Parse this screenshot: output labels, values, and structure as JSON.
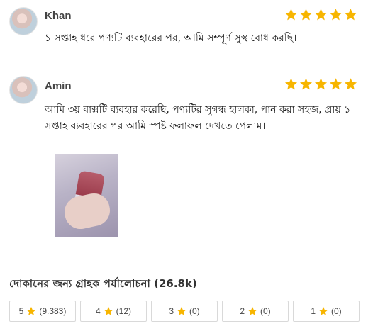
{
  "reviews": [
    {
      "name": "Khan",
      "rating": 5,
      "text": "১ সপ্তাহ ধরে পণ্যটি ব্যবহারের পর, আমি সম্পূর্ণ সুস্থ বোধ করছি।",
      "has_photo": false
    },
    {
      "name": "Amin",
      "rating": 5,
      "text": "আমি ৩য় বাক্সটি ব্যবহার করেছি, পণ্যটির সুগন্ধ হালকা, পান করা সহজ, প্রায় ১ সপ্তাহ ব্যবহারের পর আমি স্পষ্ট ফলাফল দেখতে পেলাম।",
      "has_photo": true
    }
  ],
  "summary": {
    "title": "দোকানের জন্য গ্রাহক পর্যালোচনা (26.8k)",
    "filters": [
      {
        "stars": "5",
        "count": "(9.383)"
      },
      {
        "stars": "4",
        "count": "(12)"
      },
      {
        "stars": "3",
        "count": "(0)"
      },
      {
        "stars": "2",
        "count": "(0)"
      },
      {
        "stars": "1",
        "count": "(0)"
      }
    ]
  },
  "colors": {
    "star": "#f7b500",
    "border": "#d9d9d9"
  }
}
